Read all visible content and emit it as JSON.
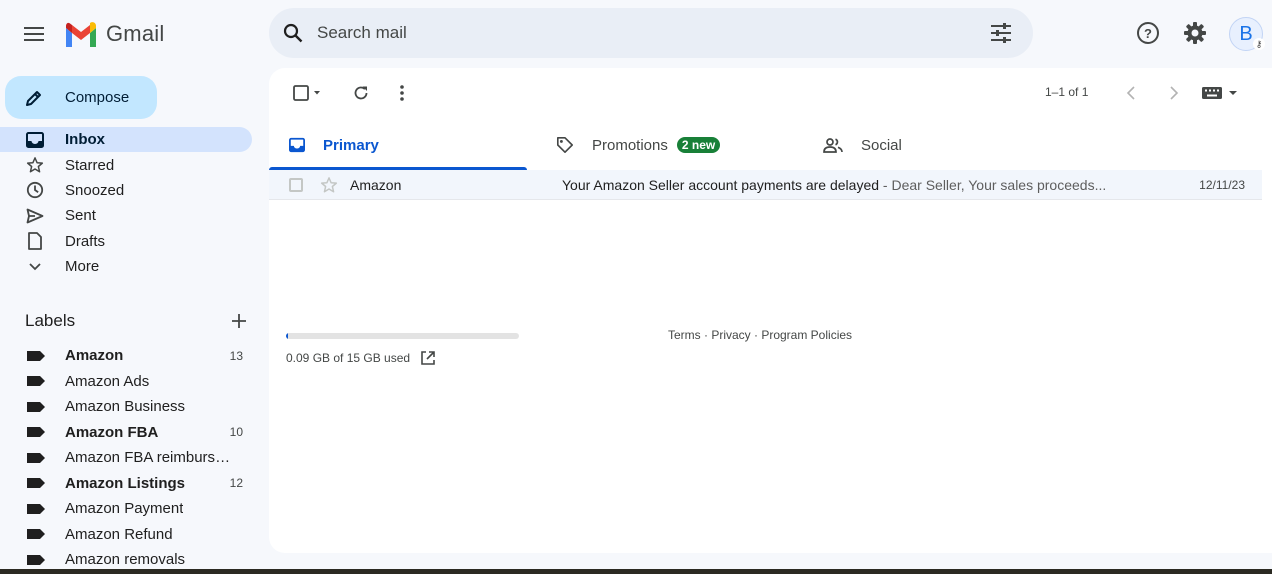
{
  "header": {
    "logo_text": "Gmail",
    "search_placeholder": "Search mail",
    "avatar_letter": "B"
  },
  "sidebar": {
    "compose_label": "Compose",
    "nav": [
      {
        "label": "Inbox",
        "icon": "inbox-icon",
        "active": true
      },
      {
        "label": "Starred",
        "icon": "star-icon"
      },
      {
        "label": "Snoozed",
        "icon": "clock-icon"
      },
      {
        "label": "Sent",
        "icon": "send-icon"
      },
      {
        "label": "Drafts",
        "icon": "draft-icon"
      },
      {
        "label": "More",
        "icon": "chevron-down-icon"
      }
    ],
    "labels_title": "Labels",
    "labels": [
      {
        "name": "Amazon",
        "count": "13",
        "bold": true
      },
      {
        "name": "Amazon Ads",
        "count": ""
      },
      {
        "name": "Amazon Business",
        "count": ""
      },
      {
        "name": "Amazon FBA",
        "count": "10",
        "bold": true
      },
      {
        "name": "Amazon FBA reimburse...",
        "count": ""
      },
      {
        "name": "Amazon Listings",
        "count": "12",
        "bold": true
      },
      {
        "name": "Amazon Payment",
        "count": ""
      },
      {
        "name": "Amazon Refund",
        "count": ""
      },
      {
        "name": "Amazon removals",
        "count": ""
      }
    ]
  },
  "toolbar": {
    "pager": "1–1 of 1"
  },
  "tabs": [
    {
      "label": "Primary",
      "icon": "inbox-icon",
      "active": true
    },
    {
      "label": "Promotions",
      "icon": "tag-icon",
      "badge": "2 new"
    },
    {
      "label": "Social",
      "icon": "people-icon"
    }
  ],
  "emails": [
    {
      "sender": "Amazon",
      "subject": "Your Amazon Seller account payments are delayed",
      "snippet": " - Dear Seller, Your sales proceeds...",
      "date": "12/11/23"
    }
  ],
  "storage": {
    "text": "0.09 GB of 15 GB used",
    "used_fraction": 0.006
  },
  "footer": {
    "links": "Terms · Privacy · Program Policies"
  },
  "colors": {
    "accent": "#0b57d0",
    "compose_bg": "#c2e7ff",
    "active_nav_bg": "#d3e3fd",
    "badge_green": "#188038"
  }
}
